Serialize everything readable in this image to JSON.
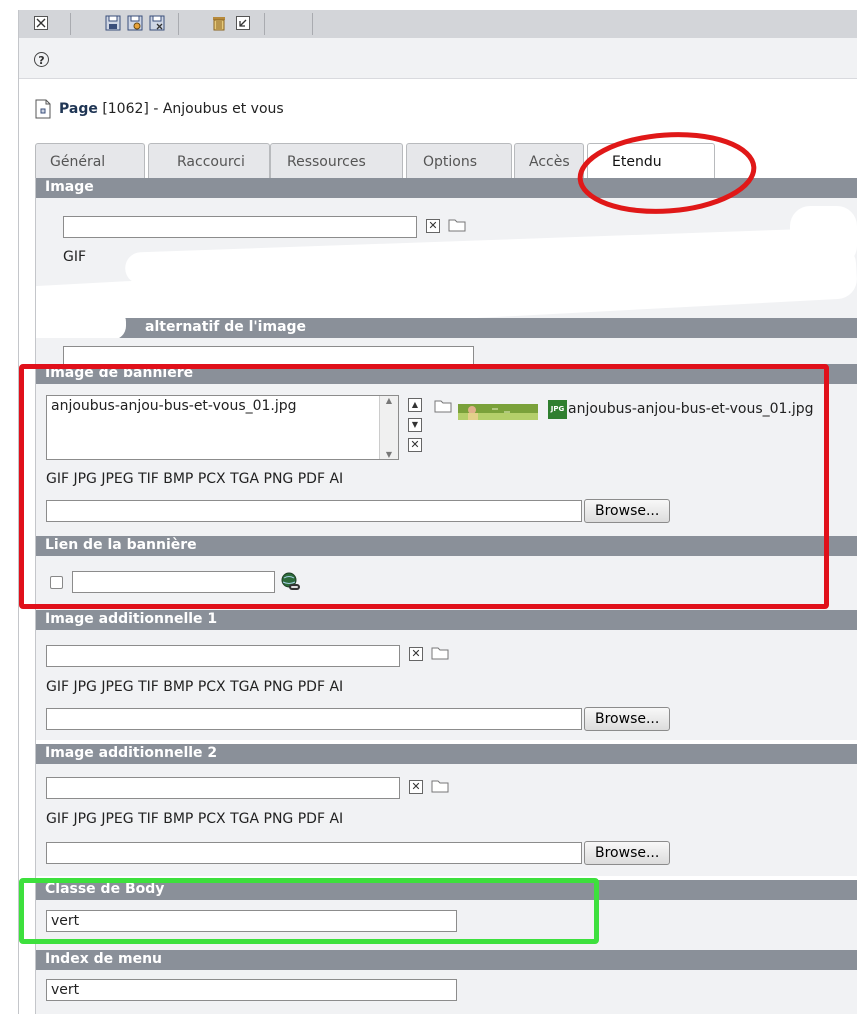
{
  "toolbar": {
    "icons": [
      "close-icon",
      "save-icon",
      "save-view-icon",
      "save-close-icon",
      "delete-icon",
      "undo-icon"
    ]
  },
  "help_icon": "?",
  "page": {
    "label": "Page",
    "id": "[1062]",
    "title_suffix": "- Anjoubus et vous"
  },
  "tabs": [
    {
      "label": "Général"
    },
    {
      "label": "Raccourci"
    },
    {
      "label": "Ressources"
    },
    {
      "label": "Options"
    },
    {
      "label": "Accès"
    },
    {
      "label": "Etendu",
      "active": true
    }
  ],
  "sections": {
    "image": {
      "title": "Image",
      "formats_partial": "GIF"
    },
    "alt": {
      "title": "alternatif de l'image"
    },
    "banner": {
      "title": "Image de bannière",
      "selected_file": "anjoubus-anjou-bus-et-vous_01.jpg",
      "preview_file": "anjoubus-anjou-bus-et-vous_01.jpg",
      "file_badge": "JPG",
      "formats": "GIF JPG JPEG TIF BMP PCX TGA PNG PDF AI",
      "browse": "Browse..."
    },
    "banner_link": {
      "title": "Lien de la bannière"
    },
    "extra1": {
      "title": "Image additionnelle 1",
      "formats": "GIF JPG JPEG TIF BMP PCX TGA PNG PDF AI",
      "browse": "Browse..."
    },
    "extra2": {
      "title": "Image additionnelle 2",
      "formats": "GIF JPG JPEG TIF BMP PCX TGA PNG PDF AI",
      "browse": "Browse..."
    },
    "body_class": {
      "title": "Classe de Body",
      "value": "vert"
    },
    "menu_index": {
      "title": "Index de menu",
      "value": "vert"
    }
  },
  "annotation_colors": {
    "tab_circle": "#e01818",
    "banner_box": "#e0101a",
    "body_box": "#3de03d"
  }
}
